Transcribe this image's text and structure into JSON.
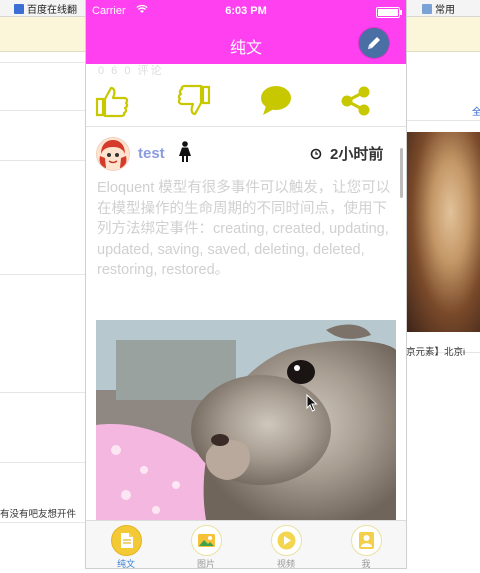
{
  "browser": {
    "bookmarks": [
      {
        "label": "百度在线翻"
      },
      {
        "label": "常用"
      }
    ],
    "background_texts": {
      "top_right": "全",
      "caption": "京元素】北京i",
      "left_snippet": "有没有吧友想开件"
    }
  },
  "status_bar": {
    "carrier": "Carrier",
    "time": "6:03 PM"
  },
  "nav": {
    "title": "纯文",
    "edit_icon": "pencil-icon"
  },
  "post_stats_ghost": "0 6  0 评论",
  "actions": [
    {
      "icon": "thumbs-up-icon"
    },
    {
      "icon": "thumbs-down-icon"
    },
    {
      "icon": "comment-icon"
    },
    {
      "icon": "share-icon"
    }
  ],
  "post": {
    "username": "test",
    "gender_icon": "female-icon",
    "time": "2小时前",
    "body": "Eloquent 模型有很多事件可以触发，让您可以在模型操作的生命周期的不同时间点，使用下列方法绑定事件：creating, created, updating, updated, saving, saved, deleting, deleted, restoring, restored。",
    "image": "squirrel-photo"
  },
  "tabs": [
    {
      "label": "纯文",
      "active": true
    },
    {
      "label": "图片",
      "active": false
    },
    {
      "label": "视频",
      "active": false
    },
    {
      "label": "我",
      "active": false
    }
  ],
  "colors": {
    "nav_bg": "#fe40f0",
    "accent": "#c8c800",
    "tab_active": "#3a7fd0",
    "username": "#8a9be0"
  }
}
